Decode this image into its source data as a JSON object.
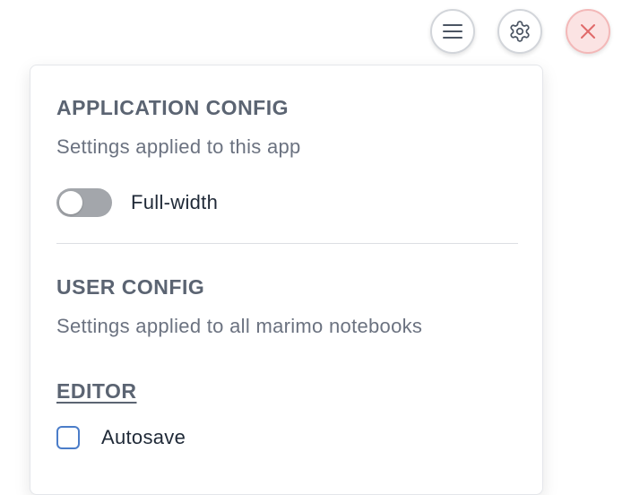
{
  "toolbar": {
    "menu_icon": "hamburger-menu-icon",
    "settings_icon": "gear-icon",
    "close_icon": "close-icon",
    "close_color": "#e06a6a"
  },
  "app_config": {
    "title": "APPLICATION CONFIG",
    "subtitle": "Settings applied to this app",
    "full_width_label": "Full-width",
    "full_width_enabled": false
  },
  "user_config": {
    "title": "USER CONFIG",
    "subtitle": "Settings applied to all marimo notebooks",
    "editor": {
      "heading": "EDITOR",
      "autosave_label": "Autosave",
      "autosave_checked": false
    }
  },
  "colors": {
    "heading": "#5b6472",
    "checkbox_border": "#4b7dc9",
    "toggle_off": "#a3a6ab"
  }
}
